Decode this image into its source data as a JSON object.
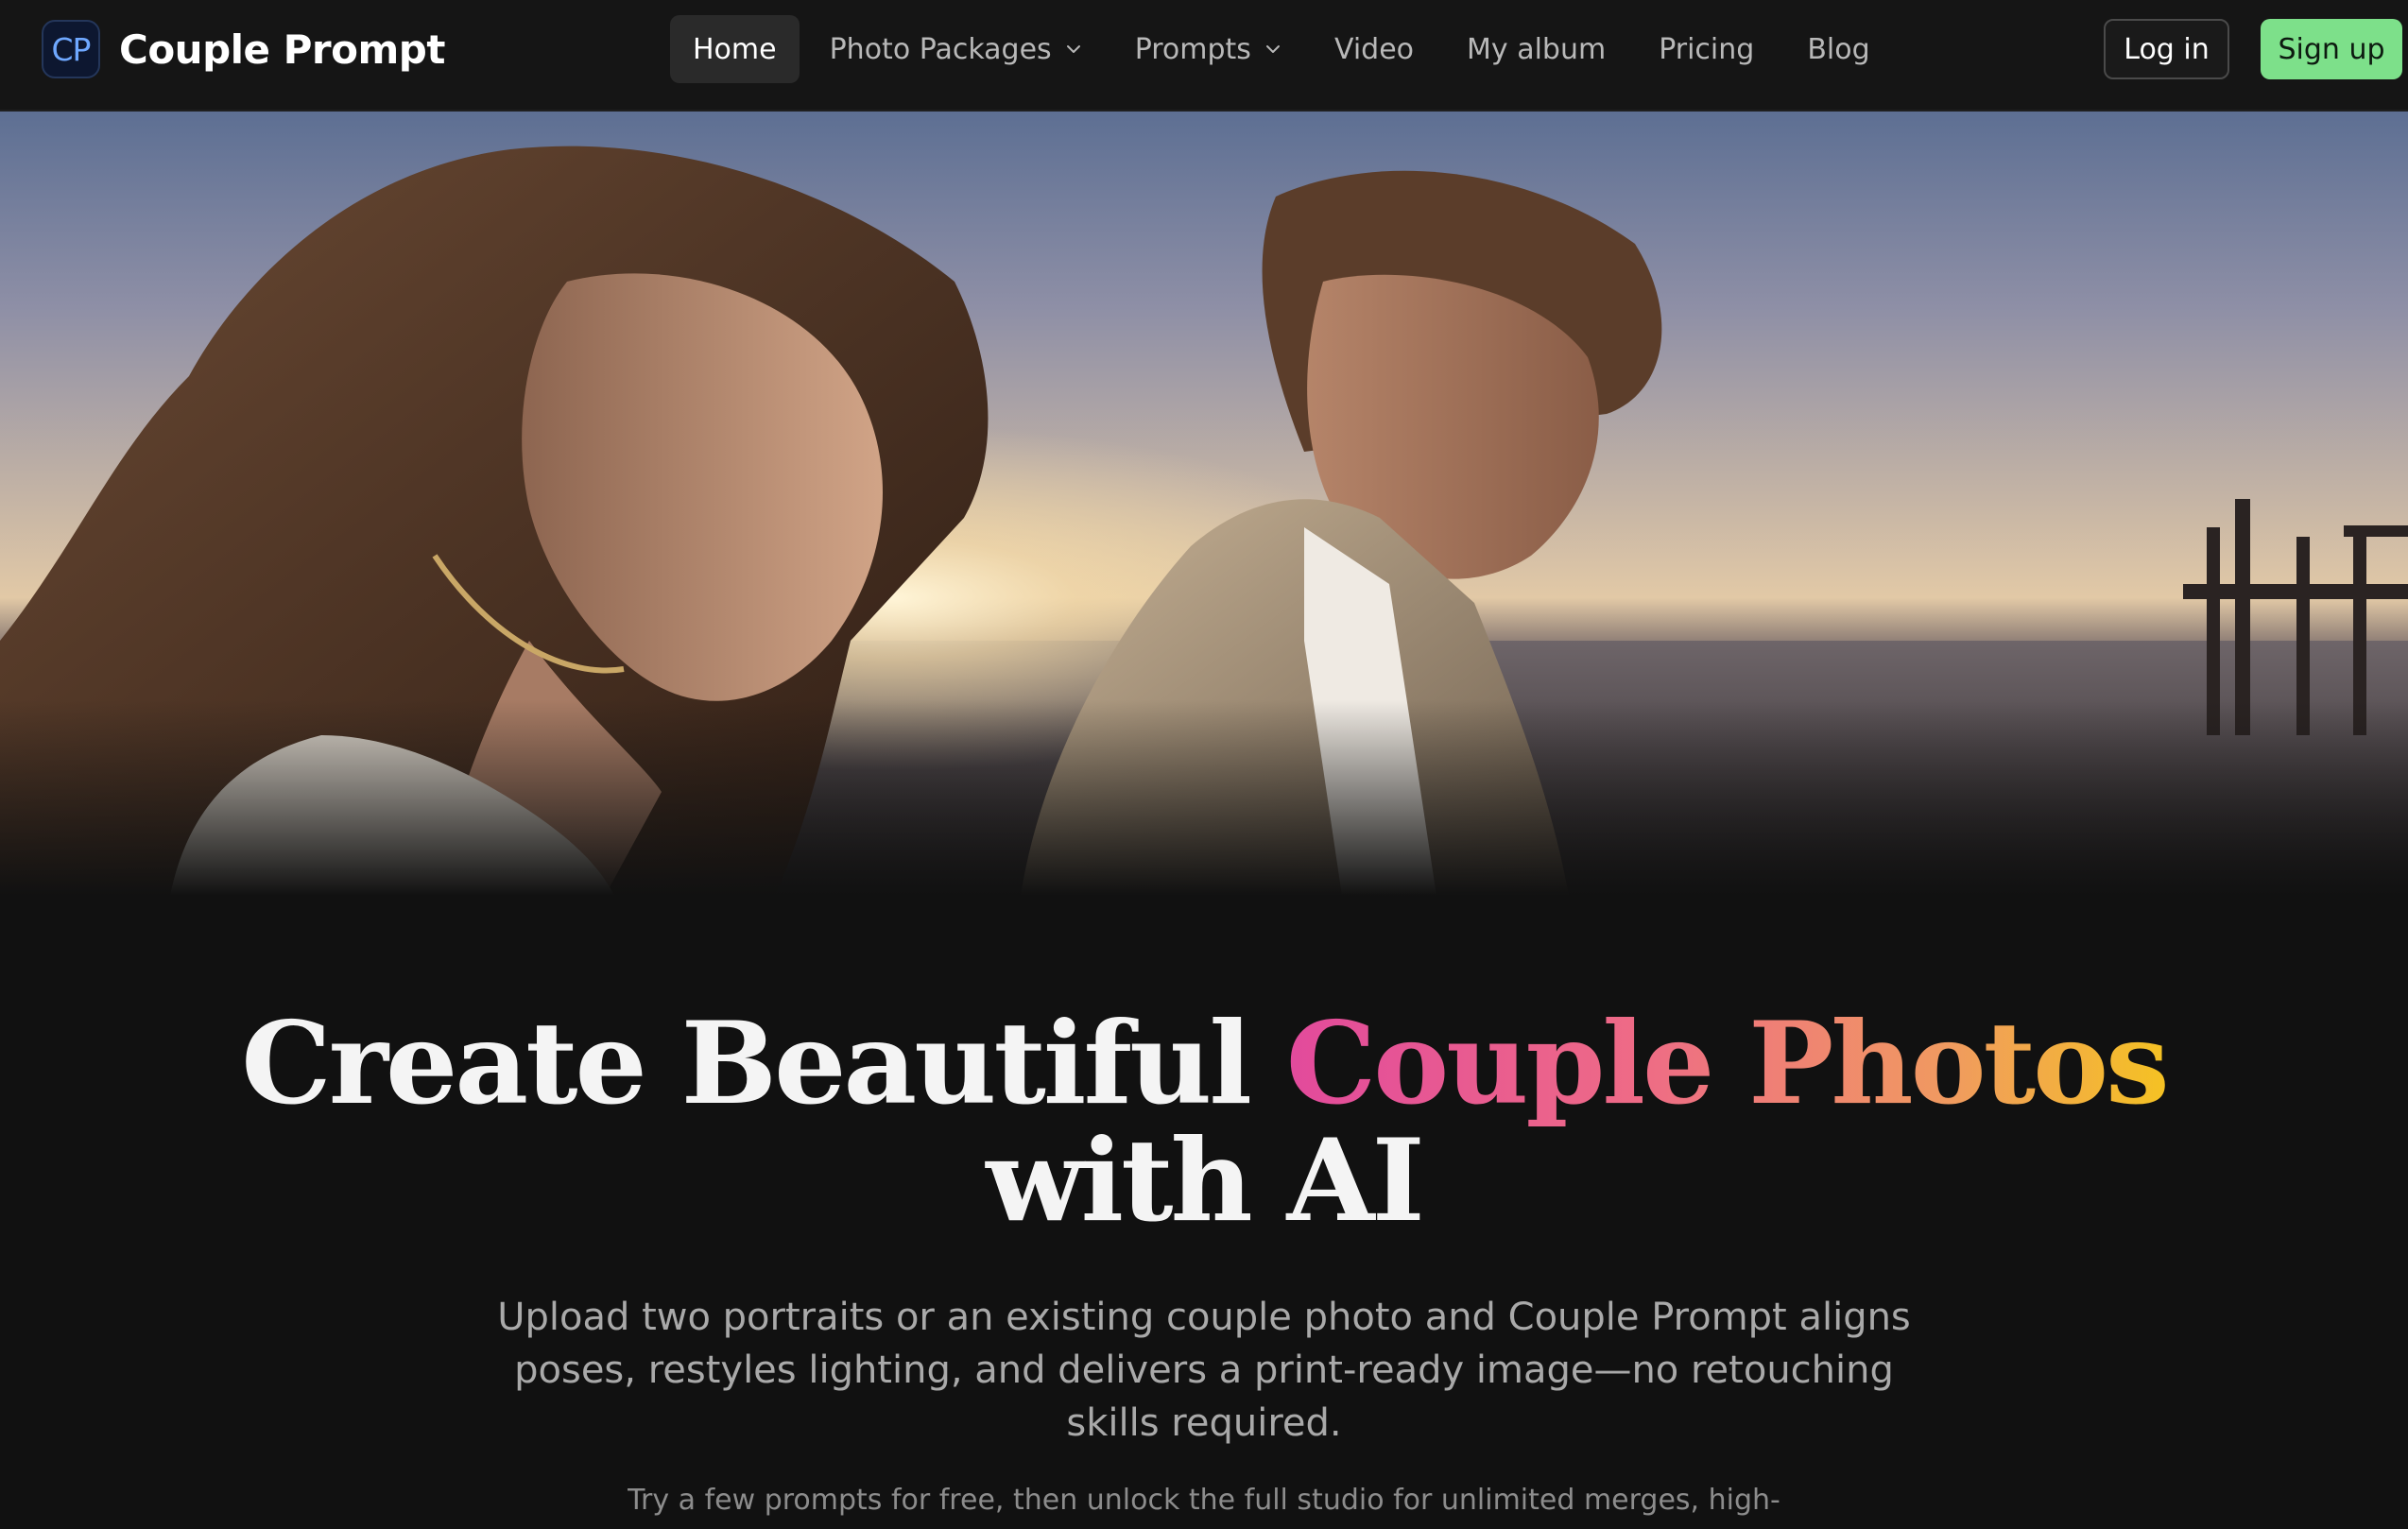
{
  "navbar": {
    "logo_text": "CP",
    "brand_name": "Couple Prompt",
    "links": [
      {
        "label": "Home",
        "active": true,
        "dropdown": false
      },
      {
        "label": "Photo Packages",
        "active": false,
        "dropdown": true
      },
      {
        "label": "Prompts",
        "active": false,
        "dropdown": true
      },
      {
        "label": "Video",
        "active": false,
        "dropdown": false
      },
      {
        "label": "My album",
        "active": false,
        "dropdown": false
      },
      {
        "label": "Pricing",
        "active": false,
        "dropdown": false
      },
      {
        "label": "Blog",
        "active": false,
        "dropdown": false
      }
    ],
    "login_label": "Log in",
    "signup_label": "Sign up"
  },
  "hero": {
    "headline_part1": "Create Beautiful",
    "headline_highlight": "Couple Photos",
    "headline_part2": "with AI",
    "subtitle": "Upload two portraits or an existing couple photo and Couple Prompt aligns poses, restyles lighting, and delivers a print-ready image—no retouching skills required.",
    "note": "Try a few prompts for free, then unlock the full studio for unlimited merges, high-resolution"
  },
  "colors": {
    "background": "#111111",
    "signup": "#7de08a",
    "logo_accent": "#6fa8ff",
    "gradient": [
      "#e24a9c",
      "#ee6b86",
      "#f09a60",
      "#f5c223"
    ]
  }
}
